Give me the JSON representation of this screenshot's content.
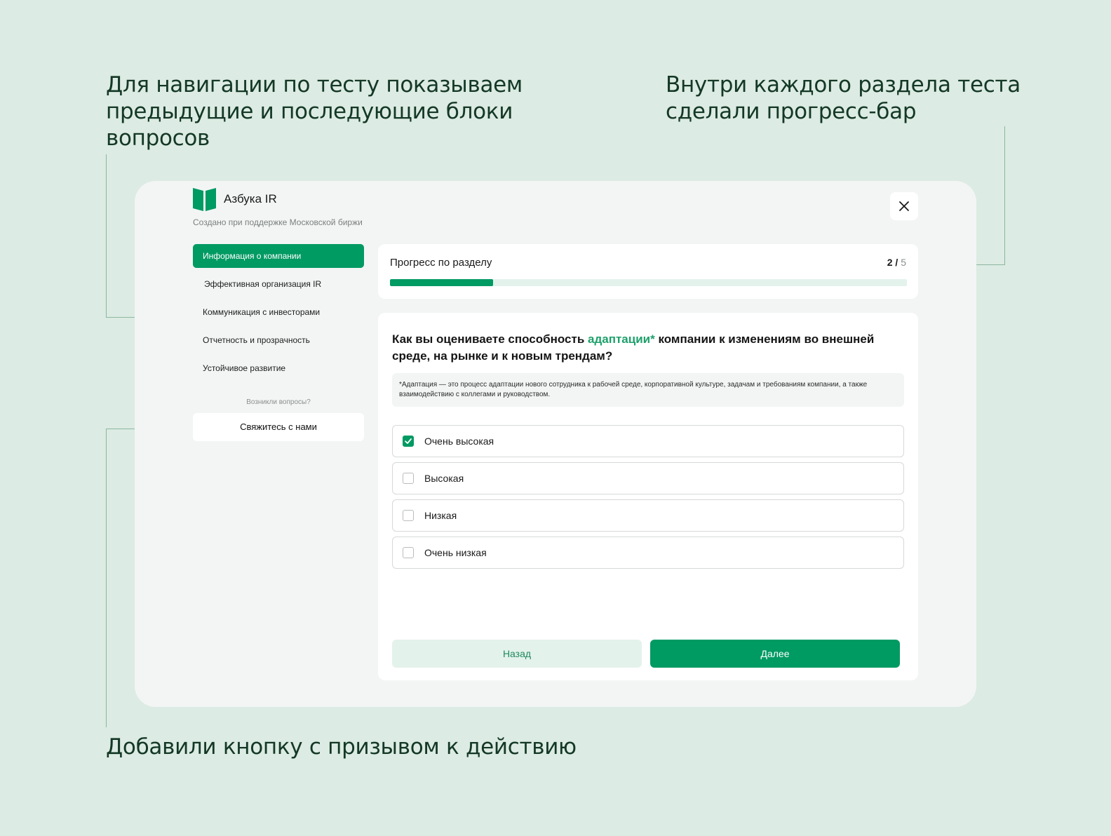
{
  "annotations": {
    "nav": "Для навигации по тесту показываем предыдущие и последующие блоки вопросов",
    "progress": "Внутри каждого раздела теста сделали прогресс-бар",
    "cta": "Добавили кнопку с призывом к действию"
  },
  "app": {
    "name": "Азбука IR",
    "subtitle": "Создано при поддержке Московской биржи"
  },
  "sidebar": {
    "items": [
      {
        "label": "Информация о компании"
      },
      {
        "label": "Эффективная организация IR"
      },
      {
        "label": "Коммуникация с инвесторами"
      },
      {
        "label": "Отчетность и прозрачность"
      },
      {
        "label": "Устойчивое развитие"
      }
    ],
    "questions_label": "Возникли вопросы?",
    "contact_label": "Свяжитесь с нами"
  },
  "progress": {
    "title": "Прогресс по разделу",
    "current": "2",
    "separator": " / ",
    "total": "5",
    "fraction": 0.2
  },
  "question": {
    "text_before": "Как вы оцениваете способность ",
    "highlight": "адаптации*",
    "text_after": " компании к изменениям во внешней среде, на рынке и к новым трендам?",
    "note": "*Адаптация — это процесс адаптации нового сотрудника к рабочей среде, корпоративной культуре, задачам и требованиям компании,  а также взаимодействию с коллегами и руководством.",
    "options": [
      {
        "label": "Очень высокая",
        "checked": true
      },
      {
        "label": "Высокая",
        "checked": false
      },
      {
        "label": "Низкая",
        "checked": false
      },
      {
        "label": "Очень низкая",
        "checked": false
      }
    ]
  },
  "buttons": {
    "back": "Назад",
    "next": "Далее"
  },
  "colors": {
    "accent": "#009a63",
    "accent_light": "#e4f2ec",
    "background": "#dcebe3"
  }
}
